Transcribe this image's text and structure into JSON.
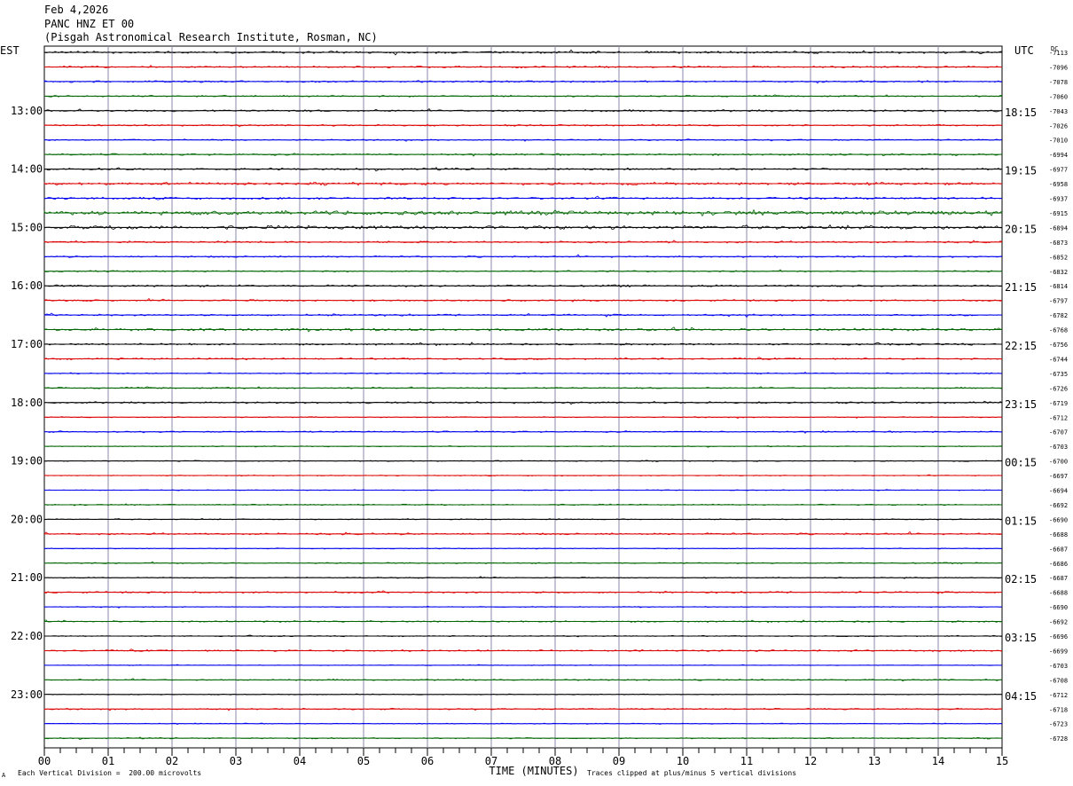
{
  "header": {
    "date": "Feb 4,2026",
    "station": "PANC HNZ ET 00",
    "institution": "(Pisgah Astronomical Research Institute, Rosman, NC)"
  },
  "footer": {
    "scale_note": "Each Vertical Division =  200.00 microvolts",
    "clip_note": "Traces clipped at plus/minus 5 vertical divisions",
    "corner_mark": "A"
  },
  "chart_data": {
    "type": "line",
    "title": "",
    "xlabel": "TIME (MINUTES)",
    "ylabel_left": "EST",
    "ylabel_right": "UTC",
    "dc_label": "DC",
    "xlim": [
      0,
      15
    ],
    "x_ticks": [
      "00",
      "01",
      "02",
      "03",
      "04",
      "05",
      "06",
      "07",
      "08",
      "09",
      "10",
      "11",
      "12",
      "13",
      "14",
      "15"
    ],
    "minor_tick_step_minutes": 0.25,
    "trace_colors": [
      "#000000",
      "#dd0000",
      "#0000ee",
      "#006600"
    ],
    "grid": true,
    "left_hour_labels": [
      {
        "trace": 4,
        "text": "13:00"
      },
      {
        "trace": 8,
        "text": "14:00"
      },
      {
        "trace": 12,
        "text": "15:00"
      },
      {
        "trace": 16,
        "text": "16:00"
      },
      {
        "trace": 20,
        "text": "17:00"
      },
      {
        "trace": 24,
        "text": "18:00"
      },
      {
        "trace": 28,
        "text": "19:00"
      },
      {
        "trace": 32,
        "text": "20:00"
      },
      {
        "trace": 36,
        "text": "21:00"
      },
      {
        "trace": 40,
        "text": "22:00"
      },
      {
        "trace": 44,
        "text": "23:00"
      }
    ],
    "right_hour_labels": [
      {
        "trace": 4,
        "text": "18:15"
      },
      {
        "trace": 8,
        "text": "19:15"
      },
      {
        "trace": 12,
        "text": "20:15"
      },
      {
        "trace": 16,
        "text": "21:15"
      },
      {
        "trace": 20,
        "text": "22:15"
      },
      {
        "trace": 24,
        "text": "23:15"
      },
      {
        "trace": 28,
        "text": "00:15"
      },
      {
        "trace": 32,
        "text": "01:15"
      },
      {
        "trace": 36,
        "text": "02:15"
      },
      {
        "trace": 40,
        "text": "03:15"
      },
      {
        "trace": 44,
        "text": "04:15"
      }
    ],
    "dc_offsets": [
      -7113,
      -7096,
      -7078,
      -7060,
      -7043,
      -7026,
      -7010,
      -6994,
      -6977,
      -6958,
      -6937,
      -6915,
      -6894,
      -6873,
      -6852,
      -6832,
      -6814,
      -6797,
      -6782,
      -6768,
      -6756,
      -6744,
      -6735,
      -6726,
      -6719,
      -6712,
      -6707,
      -6703,
      -6700,
      -6697,
      -6694,
      -6692,
      -6690,
      -6688,
      -6687,
      -6686,
      -6687,
      -6688,
      -6690,
      -6692,
      -6696,
      -6699,
      -6703,
      -6708,
      -6712,
      -6718,
      -6723,
      -6728
    ],
    "trace_activity": [
      1.2,
      0.9,
      1.0,
      0.8,
      1.1,
      0.9,
      0.8,
      1.0,
      1.1,
      1.4,
      1.2,
      2.2,
      2.0,
      1.0,
      0.9,
      0.8,
      1.1,
      0.9,
      1.0,
      1.3,
      1.0,
      0.9,
      0.7,
      0.8,
      1.0,
      0.6,
      0.8,
      0.5,
      0.6,
      0.5,
      0.5,
      0.7,
      0.6,
      1.0,
      0.5,
      0.7,
      0.6,
      0.9,
      0.5,
      0.8,
      0.6,
      0.9,
      0.4,
      0.8,
      0.5,
      0.8,
      0.5,
      0.7
    ]
  }
}
